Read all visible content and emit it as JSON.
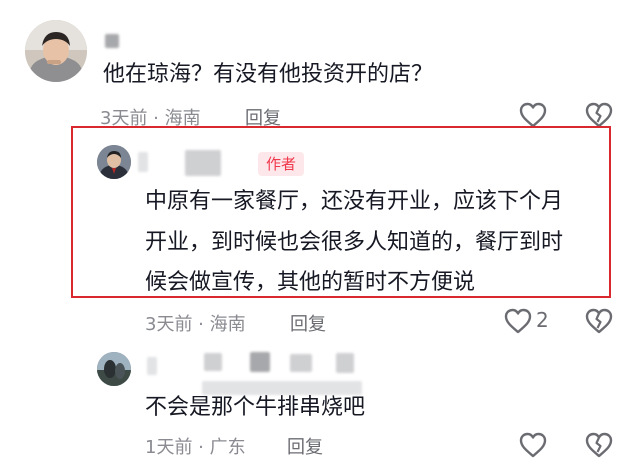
{
  "comments": [
    {
      "text": "他在琼海？有没有他投资开的店？",
      "meta": "3天前 · 海南",
      "reply_label": "回复"
    },
    {
      "badge": "作者",
      "lines": [
        "中原有一家餐厅，还没有开业，应该下个月",
        "开业，到时候也会很多人知道的，餐厅到时",
        "候会做宣传，其他的暂时不方便说"
      ],
      "meta": "3天前 · 海南",
      "reply_label": "回复",
      "like_count": "2"
    },
    {
      "text": "不会是那个牛排串烧吧",
      "meta": "1天前 · 广东",
      "reply_label": "回复"
    }
  ],
  "icons": {
    "like": "heart-outline-icon",
    "dislike": "broken-heart-outline-icon"
  },
  "colors": {
    "highlight_border": "#d9292f",
    "author_badge_bg": "#fde7ea",
    "author_badge_text": "#f0384c",
    "meta_text": "#8a8b91"
  }
}
